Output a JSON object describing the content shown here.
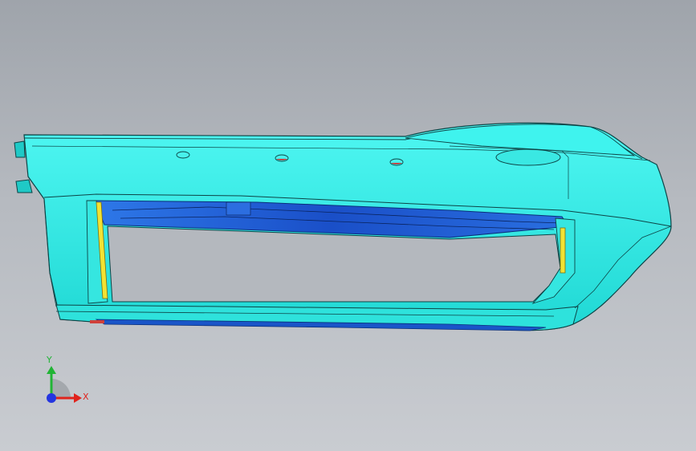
{
  "viewport": {
    "colors": {
      "part_face": "#2af0ea",
      "part_edge": "#0d4446",
      "interior": "#1e5ed8",
      "clip": "#f2e233",
      "hole": "#e01818"
    }
  },
  "triad": {
    "y_label": "Y",
    "x_label": "X",
    "colors": {
      "x": "#e0231c",
      "y": "#21b435",
      "z": "#2435e0"
    }
  }
}
